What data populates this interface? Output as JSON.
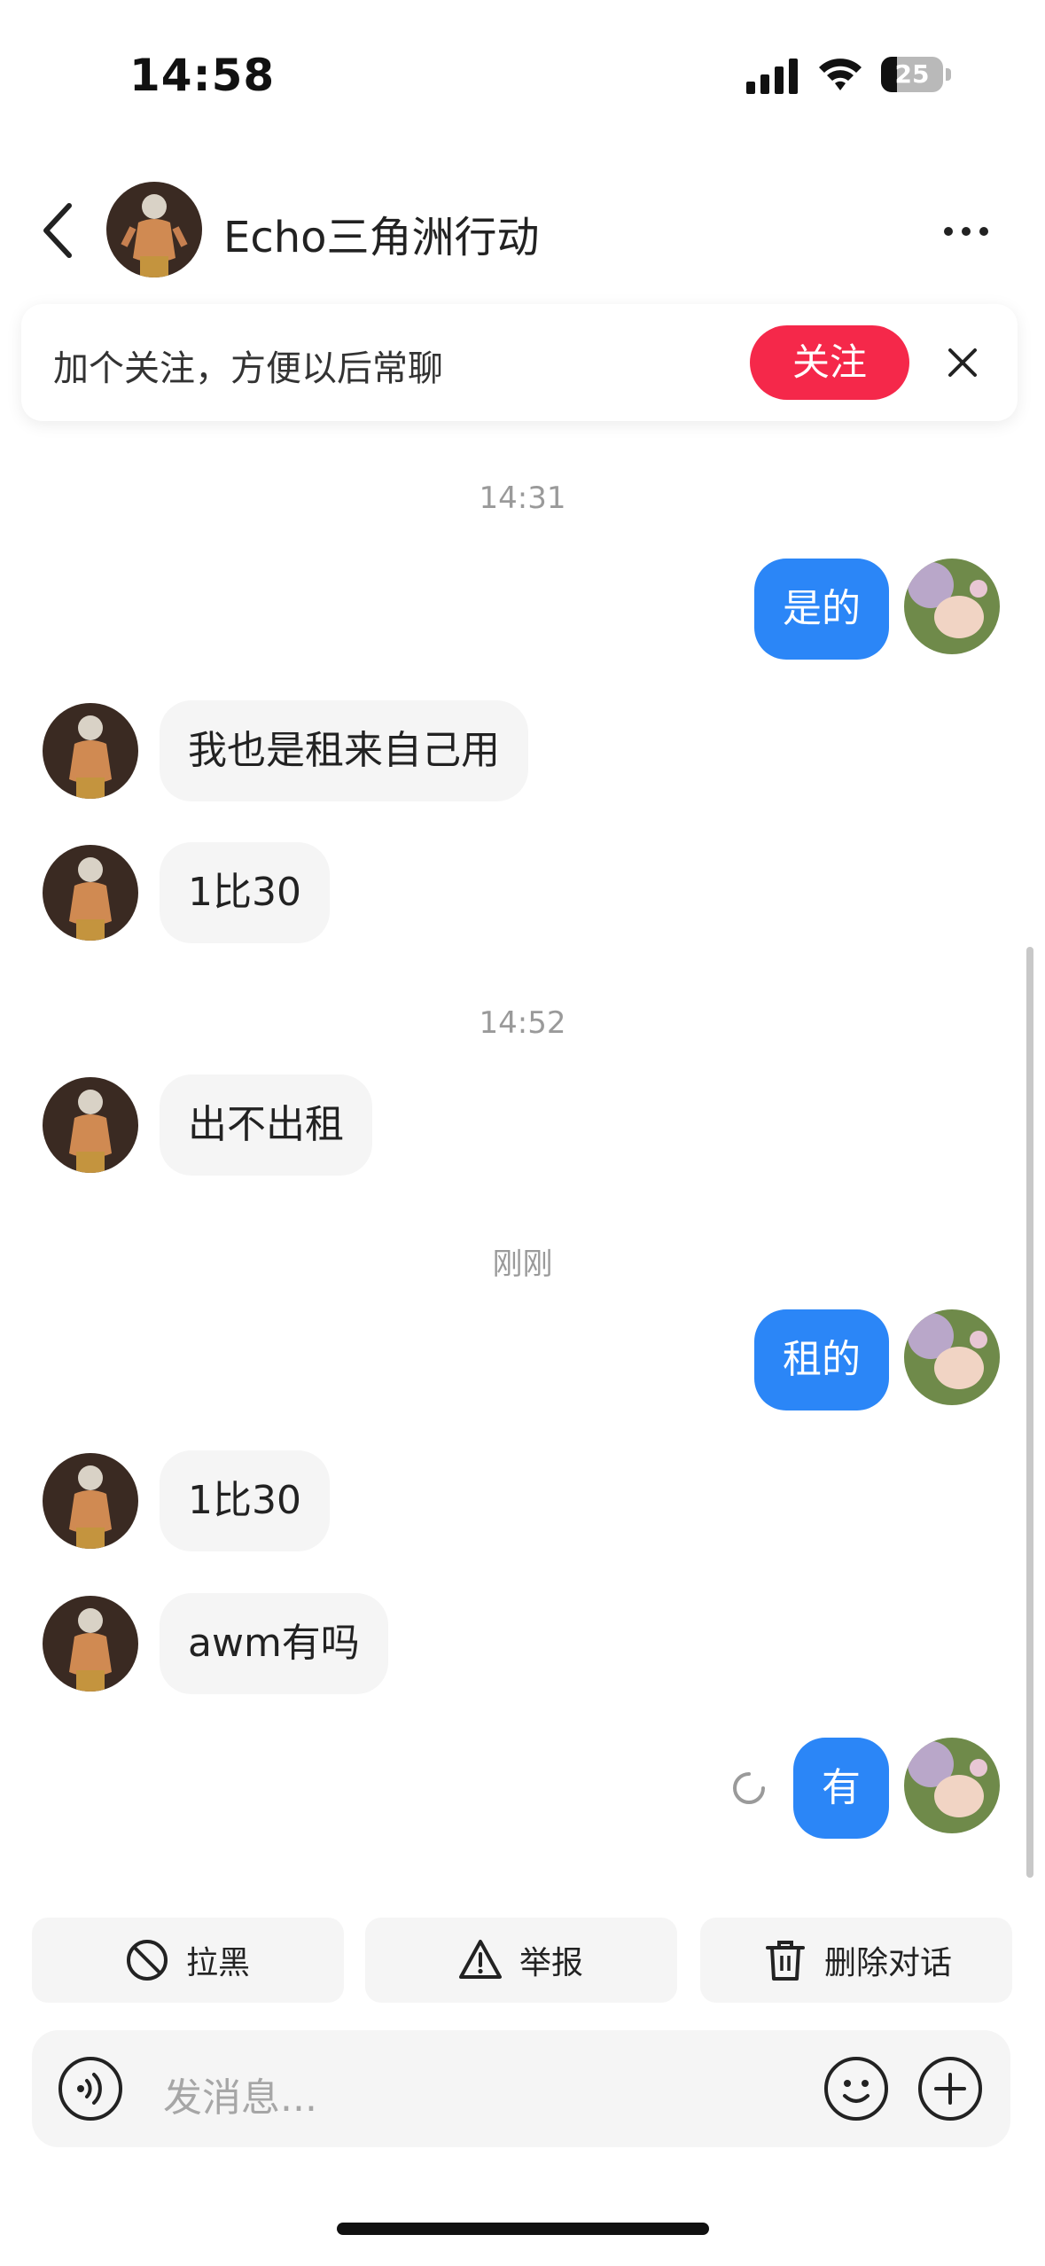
{
  "status_bar": {
    "time": "14:58",
    "battery": "25",
    "battery_fraction": 0.25
  },
  "header": {
    "title": "Echo三角洲行动"
  },
  "follow_banner": {
    "text": "加个关注，方便以后常聊",
    "follow_button": "关注"
  },
  "timestamps": [
    "14:31",
    "14:52",
    "刚刚"
  ],
  "messages": [
    {
      "side": "out",
      "text": "是的"
    },
    {
      "side": "in",
      "text": "我也是租来自己用"
    },
    {
      "side": "in",
      "text": "1比30"
    },
    {
      "side": "in",
      "text": "出不出租"
    },
    {
      "side": "out",
      "text": "租的"
    },
    {
      "side": "in",
      "text": "1比30"
    },
    {
      "side": "in",
      "text": "awm有吗"
    },
    {
      "side": "out",
      "text": "有",
      "status": "sending"
    }
  ],
  "actions": {
    "block": "拉黑",
    "report": "举报",
    "delete": "删除对话"
  },
  "composer": {
    "placeholder": "发消息..."
  },
  "colors": {
    "accent_blue": "#2b86f7",
    "follow_red": "#f5284a",
    "bubble_gray": "#f5f5f5"
  },
  "icons": [
    "back-arrow-icon",
    "more-dots-icon",
    "close-icon",
    "block-icon",
    "warning-icon",
    "trash-icon",
    "voice-icon",
    "emoji-icon",
    "plus-icon",
    "loading-spinner-icon"
  ]
}
